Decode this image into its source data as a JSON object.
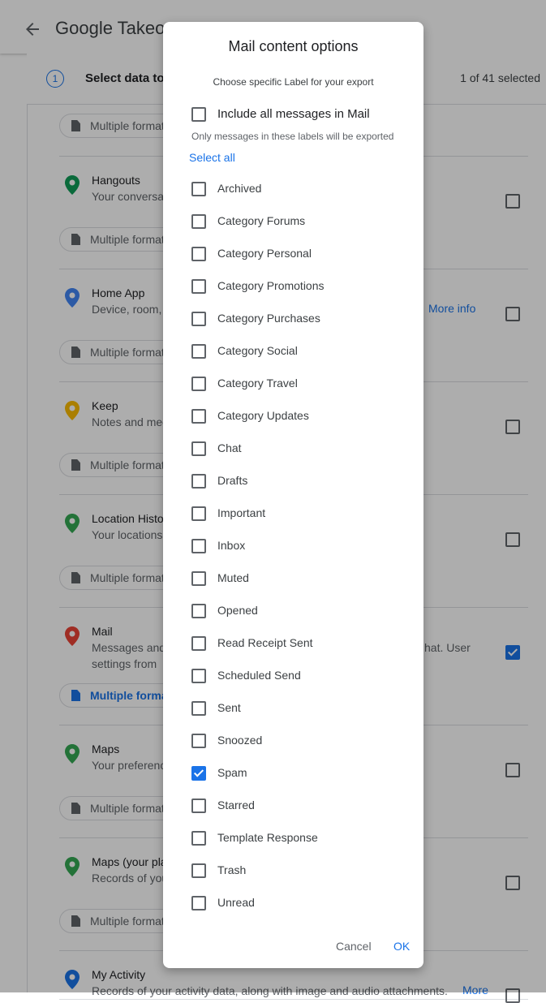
{
  "app": {
    "title": "Google Takeout"
  },
  "step": {
    "number": "1",
    "label": "Select data to include",
    "count": "1 of 41 selected"
  },
  "format_label": "Multiple formats",
  "more_info": "More info",
  "products": [
    {
      "name": "Hangouts",
      "desc": "Your conversations",
      "desc2": "",
      "checked": false,
      "icon": "hangouts-icon"
    },
    {
      "name": "Home App",
      "desc": "Device, room,",
      "desc2": "",
      "checked": false,
      "icon": "home-app-icon",
      "more": "More info"
    },
    {
      "name": "Keep",
      "desc": "Notes and media",
      "desc2": "",
      "checked": false,
      "icon": "keep-icon"
    },
    {
      "name": "Location History",
      "desc": "Your locations",
      "desc2": "",
      "checked": false,
      "icon": "location-history-icon"
    },
    {
      "name": "Mail",
      "desc": "Messages and",
      "desc2": "settings from",
      "desc_tail": "hat. User",
      "checked": true,
      "icon": "gmail-icon"
    },
    {
      "name": "Maps",
      "desc": "Your preferences",
      "desc2": "",
      "checked": false,
      "icon": "maps-icon"
    },
    {
      "name": "Maps (your places)",
      "desc": "Records of your",
      "desc2": "",
      "checked": false,
      "icon": "maps-places-icon"
    },
    {
      "name": "My Activity",
      "desc": "Records of your activity data, along with image and audio attachments.",
      "desc2": "",
      "checked": false,
      "icon": "my-activity-icon",
      "more": "More"
    }
  ],
  "dialog": {
    "title": "Mail content options",
    "subtitle": "Choose specific Label for your export",
    "include_all": {
      "label": "Include all messages in Mail",
      "checked": false
    },
    "note": "Only messages in these labels will be exported",
    "select_all": "Select all",
    "labels": [
      {
        "label": "Archived",
        "checked": false
      },
      {
        "label": "Category Forums",
        "checked": false
      },
      {
        "label": "Category Personal",
        "checked": false
      },
      {
        "label": "Category Promotions",
        "checked": false
      },
      {
        "label": "Category Purchases",
        "checked": false
      },
      {
        "label": "Category Social",
        "checked": false
      },
      {
        "label": "Category Travel",
        "checked": false
      },
      {
        "label": "Category Updates",
        "checked": false
      },
      {
        "label": "Chat",
        "checked": false
      },
      {
        "label": "Drafts",
        "checked": false
      },
      {
        "label": "Important",
        "checked": false
      },
      {
        "label": "Inbox",
        "checked": false
      },
      {
        "label": "Muted",
        "checked": false
      },
      {
        "label": "Opened",
        "checked": false
      },
      {
        "label": "Read Receipt Sent",
        "checked": false
      },
      {
        "label": "Scheduled Send",
        "checked": false
      },
      {
        "label": "Sent",
        "checked": false
      },
      {
        "label": "Snoozed",
        "checked": false
      },
      {
        "label": "Spam",
        "checked": true
      },
      {
        "label": "Starred",
        "checked": false
      },
      {
        "label": "Template Response",
        "checked": false
      },
      {
        "label": "Trash",
        "checked": false
      },
      {
        "label": "Unread",
        "checked": false
      }
    ],
    "cancel": "Cancel",
    "ok": "OK"
  },
  "colors": {
    "accent": "#1a73e8",
    "scrim": "rgba(0,0,0,0.32)"
  }
}
